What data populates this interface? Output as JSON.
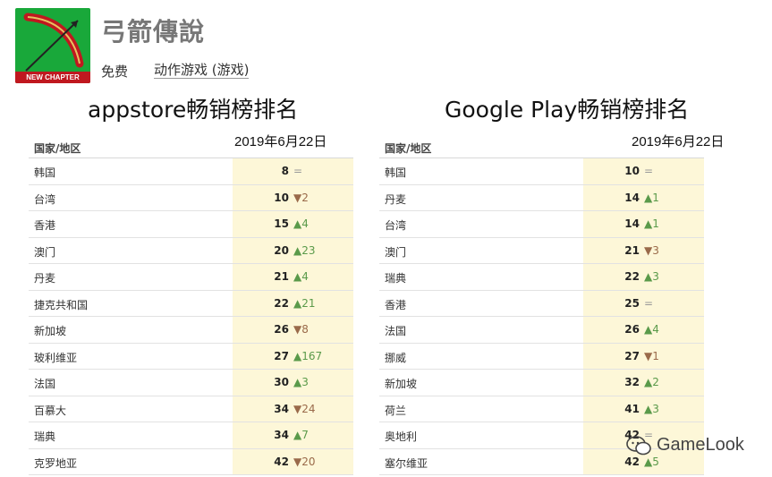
{
  "app": {
    "title": "弓箭傳說",
    "banner": "NEW CHAPTER",
    "price": "免费",
    "genre": "动作游戏 (游戏)"
  },
  "tables": [
    {
      "title": "appstore畅销榜排名",
      "col_country": "国家/地区",
      "col_date": "2019年6月22日",
      "rows": [
        {
          "country": "韩国",
          "rank": "8",
          "change": "=",
          "dir": "same"
        },
        {
          "country": "台湾",
          "rank": "10",
          "change": "▼2",
          "dir": "down"
        },
        {
          "country": "香港",
          "rank": "15",
          "change": "▲4",
          "dir": "up"
        },
        {
          "country": "澳门",
          "rank": "20",
          "change": "▲23",
          "dir": "up"
        },
        {
          "country": "丹麦",
          "rank": "21",
          "change": "▲4",
          "dir": "up"
        },
        {
          "country": "捷克共和国",
          "rank": "22",
          "change": "▲21",
          "dir": "up"
        },
        {
          "country": "新加坡",
          "rank": "26",
          "change": "▼8",
          "dir": "down"
        },
        {
          "country": "玻利维亚",
          "rank": "27",
          "change": "▲167",
          "dir": "up"
        },
        {
          "country": "法国",
          "rank": "30",
          "change": "▲3",
          "dir": "up"
        },
        {
          "country": "百慕大",
          "rank": "34",
          "change": "▼24",
          "dir": "down"
        },
        {
          "country": "瑞典",
          "rank": "34",
          "change": "▲7",
          "dir": "up"
        },
        {
          "country": "克罗地亚",
          "rank": "42",
          "change": "▼20",
          "dir": "down"
        }
      ]
    },
    {
      "title": "Google Play畅销榜排名",
      "col_country": "国家/地区",
      "col_date": "2019年6月22日",
      "rows": [
        {
          "country": "韩国",
          "rank": "10",
          "change": "=",
          "dir": "same"
        },
        {
          "country": "丹麦",
          "rank": "14",
          "change": "▲1",
          "dir": "up"
        },
        {
          "country": "台湾",
          "rank": "14",
          "change": "▲1",
          "dir": "up"
        },
        {
          "country": "澳门",
          "rank": "21",
          "change": "▼3",
          "dir": "down"
        },
        {
          "country": "瑞典",
          "rank": "22",
          "change": "▲3",
          "dir": "up"
        },
        {
          "country": "香港",
          "rank": "25",
          "change": "=",
          "dir": "same"
        },
        {
          "country": "法国",
          "rank": "26",
          "change": "▲4",
          "dir": "up"
        },
        {
          "country": "挪威",
          "rank": "27",
          "change": "▼1",
          "dir": "down"
        },
        {
          "country": "新加坡",
          "rank": "32",
          "change": "▲2",
          "dir": "up"
        },
        {
          "country": "荷兰",
          "rank": "41",
          "change": "▲3",
          "dir": "up"
        },
        {
          "country": "奥地利",
          "rank": "42",
          "change": "=",
          "dir": "same"
        },
        {
          "country": "塞尔维亚",
          "rank": "42",
          "change": "▲5",
          "dir": "up"
        }
      ]
    }
  ],
  "watermark": "GameLook",
  "colors": {
    "highlight": "#fdf7d8",
    "up": "#5a9a4a",
    "down": "#9a6a4a",
    "icon_bg": "#19a83a",
    "banner": "#c0181f"
  }
}
